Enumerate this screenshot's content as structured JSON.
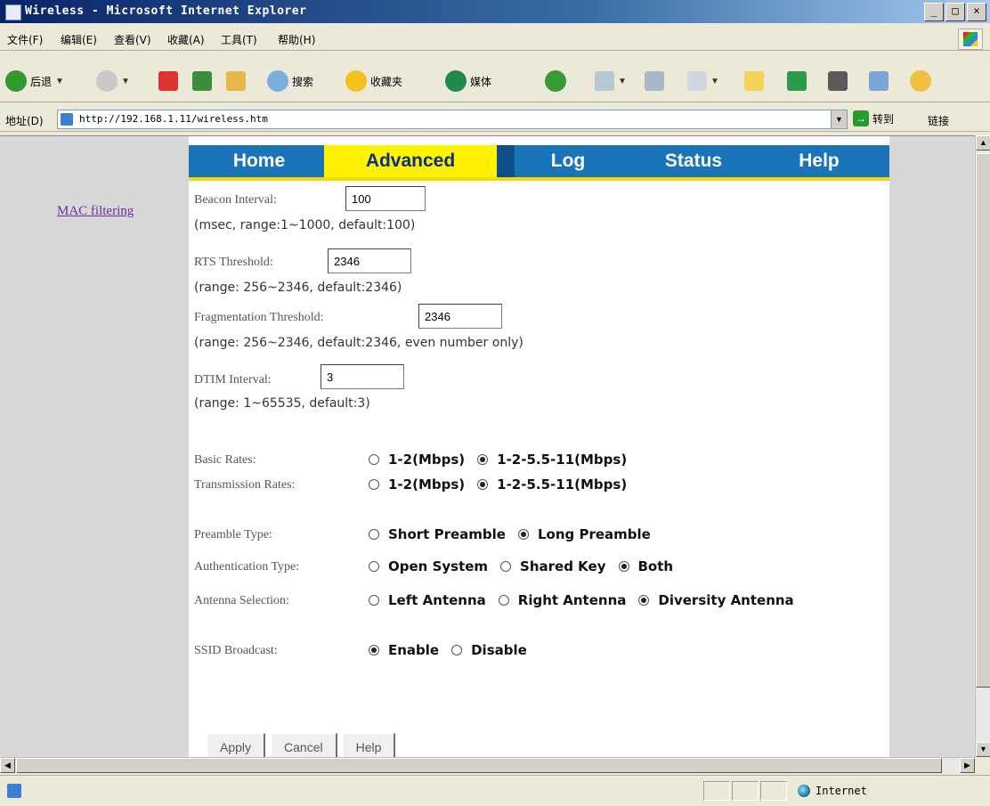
{
  "window": {
    "title": "Wireless - Microsoft Internet Explorer",
    "controls": [
      "_",
      "□",
      "×"
    ]
  },
  "menu": [
    "文件(F)",
    "编辑(E)",
    "查看(V)",
    "收藏(A)",
    "工具(T)",
    "帮助(H)"
  ],
  "toolbar": {
    "back": "后退",
    "search": "搜索",
    "favorites": "收藏夹",
    "media": "媒体"
  },
  "address": {
    "label": "地址(D)",
    "url": "http://192.168.1.11/wireless.htm",
    "go": "转到",
    "links": "链接"
  },
  "sidebar": {
    "link": "MAC filtering"
  },
  "tabs": [
    "Home",
    "Advanced",
    "Log",
    "Status",
    "Help"
  ],
  "active_tab": "Advanced",
  "form": {
    "beacon": {
      "label": "Beacon Interval:",
      "value": "100",
      "hint": "(msec, range:1~1000, default:100)"
    },
    "rts": {
      "label": "RTS Threshold:",
      "value": "2346",
      "hint": "(range: 256~2346, default:2346)"
    },
    "frag": {
      "label": "Fragmentation Threshold:",
      "value": "2346",
      "hint": "(range: 256~2346, default:2346, even number only)"
    },
    "dtim": {
      "label": "DTIM Interval:",
      "value": "3",
      "hint": "(range: 1~65535, default:3)"
    },
    "basic_rates": {
      "label": "Basic Rates:",
      "options": [
        "1-2(Mbps)",
        "1-2-5.5-11(Mbps)"
      ],
      "selected": 1
    },
    "tx_rates": {
      "label": "Transmission Rates:",
      "options": [
        "1-2(Mbps)",
        "1-2-5.5-11(Mbps)"
      ],
      "selected": 1
    },
    "preamble": {
      "label": "Preamble Type:",
      "options": [
        "Short Preamble",
        "Long Preamble"
      ],
      "selected": 1
    },
    "auth": {
      "label": "Authentication Type:",
      "options": [
        "Open System",
        "Shared Key",
        "Both"
      ],
      "selected": 2
    },
    "antenna": {
      "label": "Antenna Selection:",
      "options": [
        "Left Antenna",
        "Right Antenna",
        "Diversity Antenna"
      ],
      "selected": 2
    },
    "ssid": {
      "label": "SSID Broadcast:",
      "options": [
        "Enable",
        "Disable"
      ],
      "selected": 0
    }
  },
  "buttons": {
    "apply": "Apply",
    "cancel": "Cancel",
    "help": "Help"
  },
  "status": {
    "zone": "Internet"
  },
  "colors": {
    "tab_bar": "#1a74b8",
    "tab_active": "#fff200",
    "tab_underline": "#f6d800",
    "link": "#6b2fa0"
  }
}
